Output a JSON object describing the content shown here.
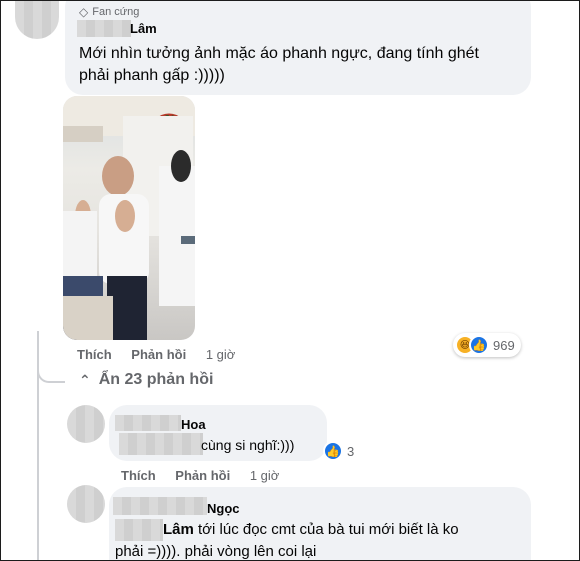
{
  "comment1": {
    "badge": "Fan cứng",
    "author": "Lâm",
    "text_line1": "Mới nhìn tưởng ảnh mặc áo phanh ngực, đang tính ghét",
    "text_line2": "phải phanh gấp :)))))",
    "actions": {
      "like": "Thích",
      "reply": "Phản hồi",
      "time": "1 giờ"
    },
    "reactions": {
      "icons": [
        "haha-icon",
        "like-icon"
      ],
      "count": "969"
    }
  },
  "replies_toggle": {
    "label": "Ẩn 23 phản hồi",
    "icon": "chevron-up-icon"
  },
  "reply1": {
    "author": "Hoa",
    "text": "cùng si nghĩ:)))",
    "actions": {
      "like": "Thích",
      "reply": "Phản hồi",
      "time": "1 giờ"
    },
    "reactions": {
      "icons": [
        "like-icon"
      ],
      "count": "3"
    }
  },
  "reply2": {
    "author": "Ngọc",
    "mention": "Lâm",
    "text_line1": " tới lúc đọc cmt của bà tui mới biết là ko",
    "text_line2": "phải =)))). phải vòng lên coi lại"
  },
  "colors": {
    "bubble": "#f0f2f5",
    "meta": "#65676b",
    "like_blue": "#1b74e4",
    "badge_gray": "#65676b"
  }
}
